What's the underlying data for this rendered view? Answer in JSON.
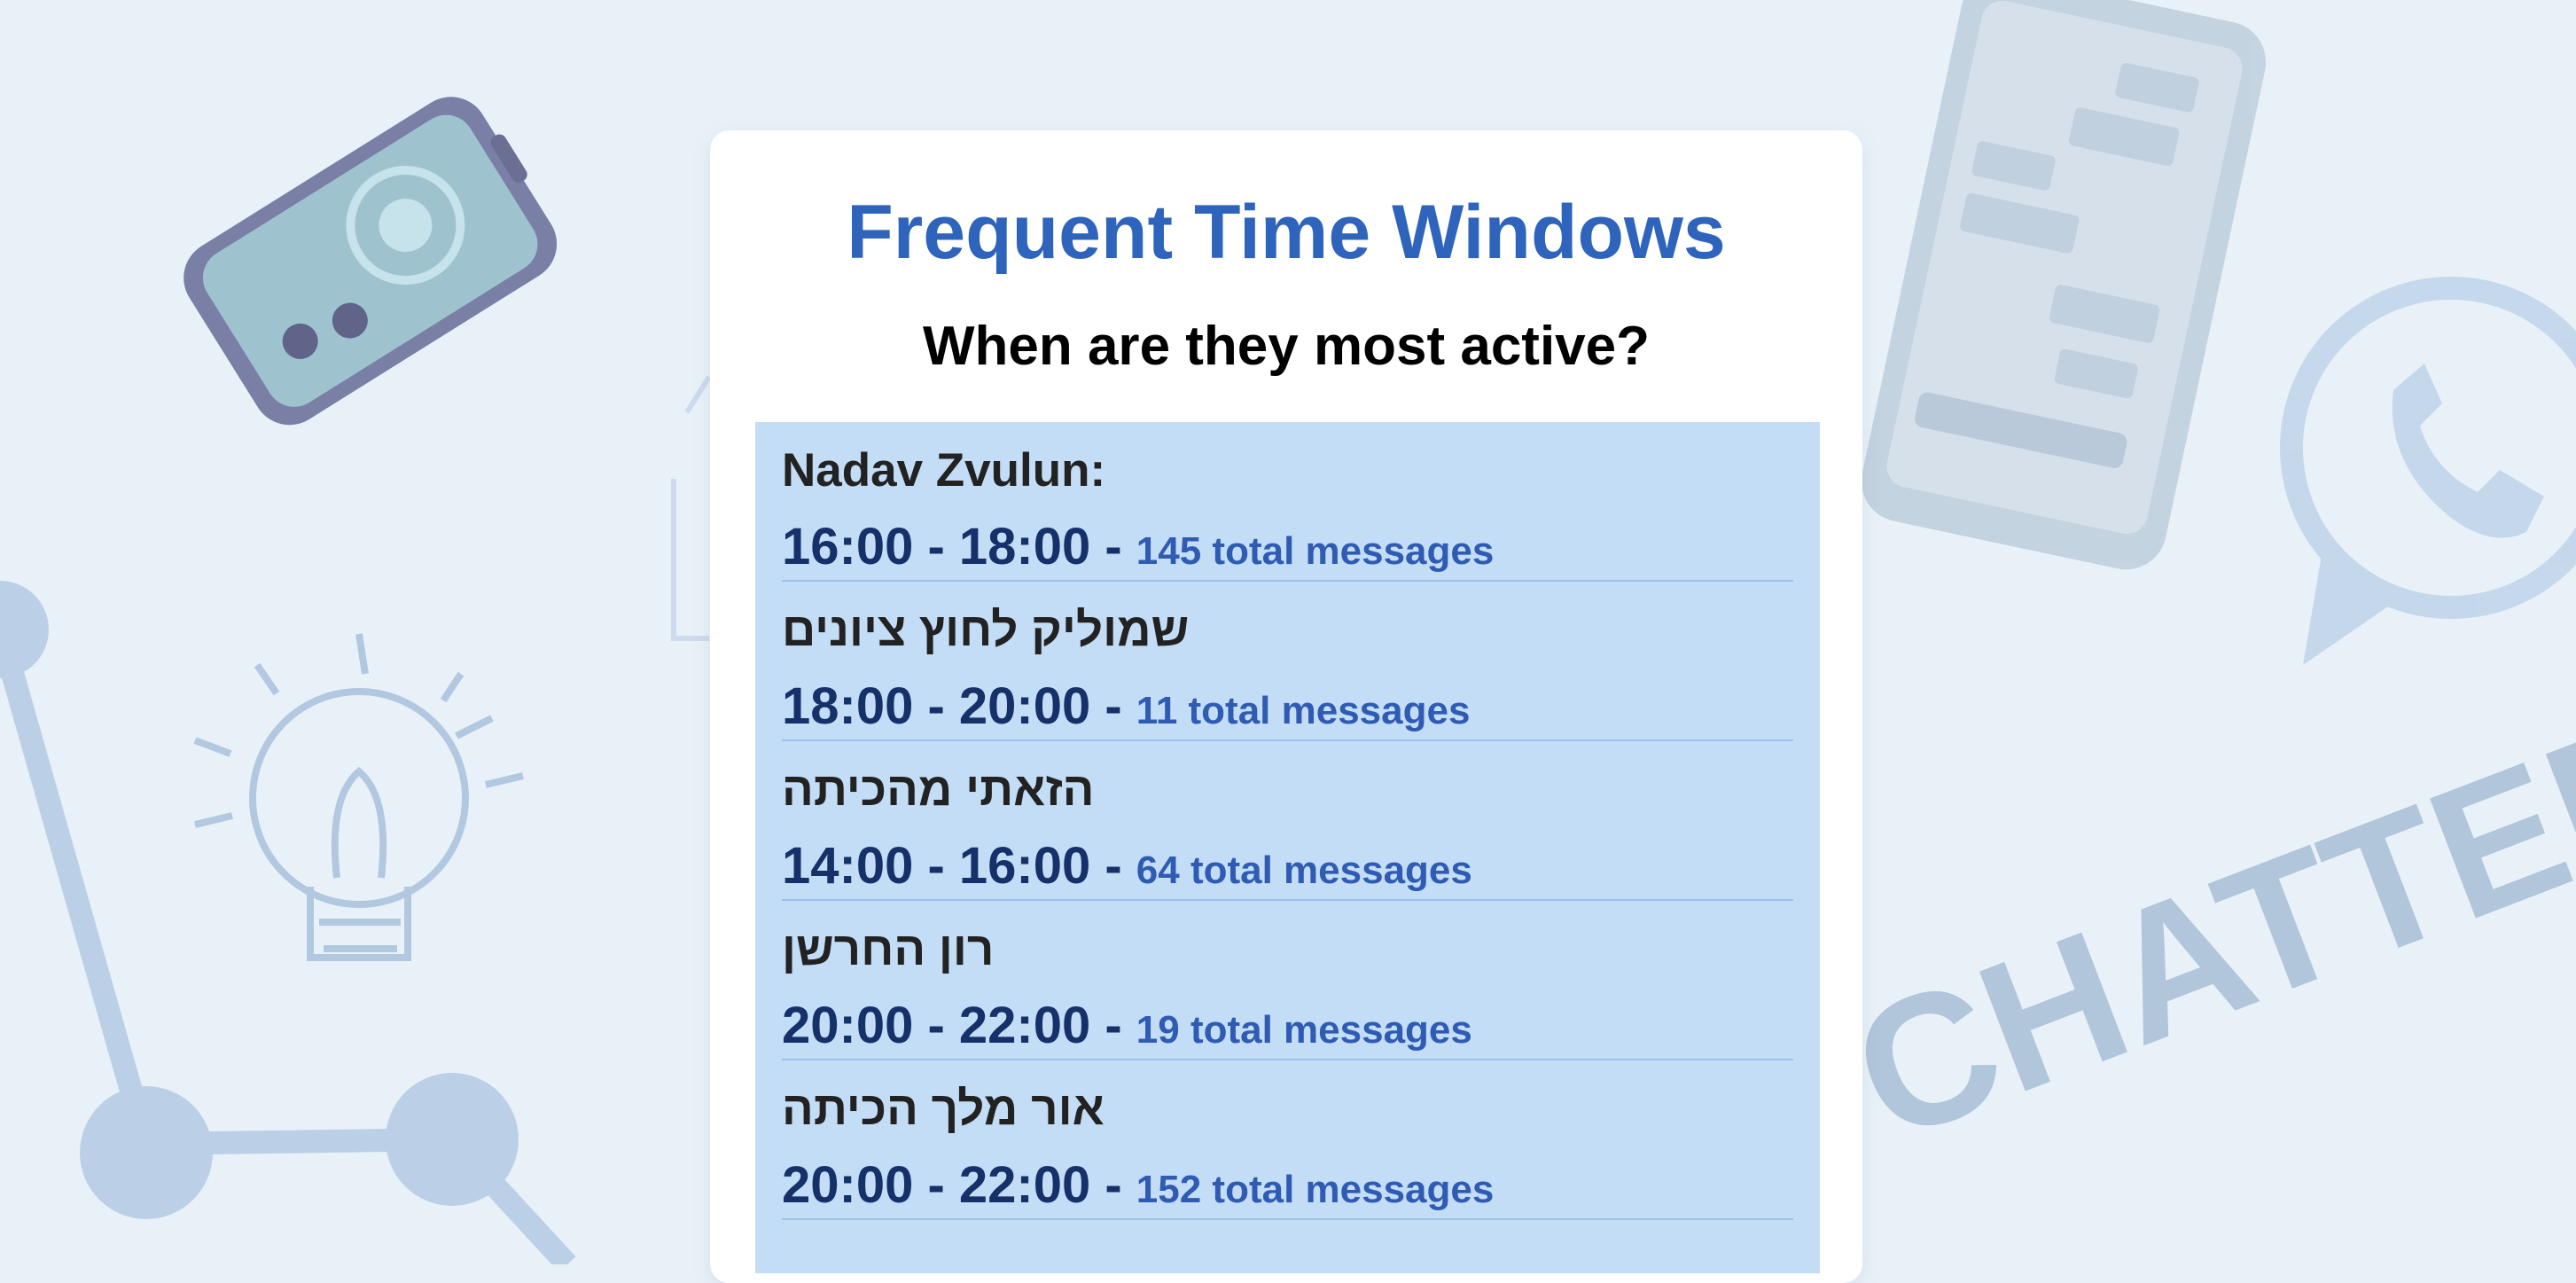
{
  "card": {
    "title": "Frequent Time Windows",
    "subtitle": "When are they most active?"
  },
  "entries": [
    {
      "name": "Nadav Zvulun:",
      "window": "16:00 - 18:00 - ",
      "count": "145 total messages"
    },
    {
      "name": "שמוליק לחוץ ציונים",
      "window": "18:00 - 20:00 - ",
      "count": "11 total messages"
    },
    {
      "name": "הזאתי מהכיתה",
      "window": "14:00 - 16:00 - ",
      "count": "64 total messages"
    },
    {
      "name": "רון החרשן",
      "window": "20:00 - 22:00 - ",
      "count": "19 total messages"
    },
    {
      "name": "אור מלך הכיתה",
      "window": "20:00 - 22:00 - ",
      "count": "152 total messages"
    }
  ],
  "background": {
    "watermark_text": "CHATTER",
    "icons": [
      "phone-icon",
      "smartphone-chat-icon",
      "whatsapp-icon",
      "lightbulb-icon",
      "network-nodes-icon"
    ]
  },
  "colors": {
    "page_background": "#e9f1f8",
    "title": "#2f64bd",
    "list_background": "#c3ddf6",
    "time_window": "#16306a",
    "message_count": "#2f5bb3"
  }
}
